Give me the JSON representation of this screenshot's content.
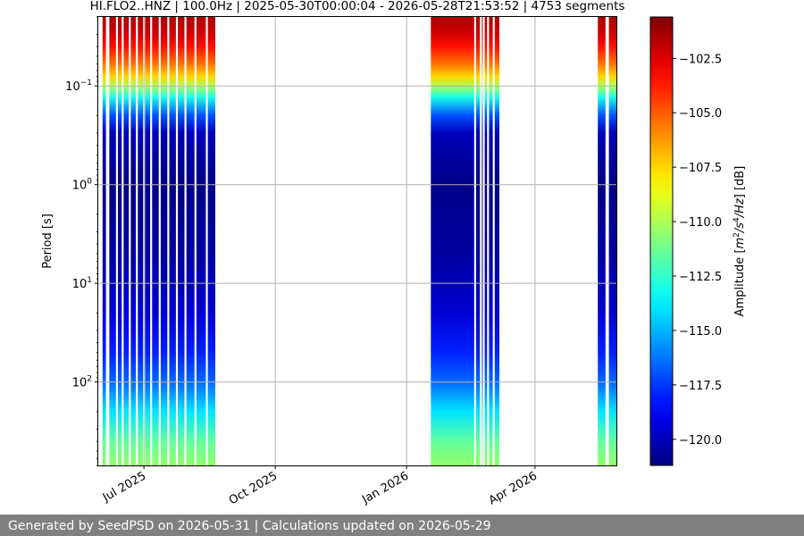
{
  "footer": {
    "text": "Generated by SeedPSD on 2026-05-31 | Calculations updated on 2026-05-29"
  },
  "colors": {
    "grid": "#b0b0b0",
    "footer_bg": "#808080"
  },
  "chart_data": {
    "type": "heatmap",
    "title": "HI.FLO2..HNZ | 100.0Hz | 2025-05-30T00:00:04 - 2026-05-28T21:53:52 | 4753 segments",
    "xlabel": "",
    "ylabel": "Period [s]",
    "colorbar_label": "Amplitude [m²/s⁴/Hz] [dB]",
    "colorbar_label_parts": {
      "prefix": "Amplitude [",
      "unit": "m",
      "e1": "2",
      "mid": "/s",
      "e2": "4",
      "tail": "/Hz",
      "suffix": "] [dB]"
    },
    "xlim": [
      "2025-05-30",
      "2026-05-28"
    ],
    "ylim_period_s": [
      0.02,
      700
    ],
    "y_scale": "log",
    "y_inverted": true,
    "colormap": "jet",
    "clim_db": [
      -121.2,
      -100.6
    ],
    "grid": true,
    "x_ticks": [
      {
        "date": "2025-07-01",
        "label": "Jul 2025"
      },
      {
        "date": "2025-10-01",
        "label": "Oct 2025"
      },
      {
        "date": "2026-01-01",
        "label": "Jan 2026"
      },
      {
        "date": "2026-04-01",
        "label": "Apr 2026"
      }
    ],
    "y_ticks": [
      {
        "value": 0.1,
        "base": "10",
        "exp": "−1"
      },
      {
        "value": 1,
        "base": "10",
        "exp": "0"
      },
      {
        "value": 10,
        "base": "10",
        "exp": "1"
      },
      {
        "value": 100,
        "base": "10",
        "exp": "2"
      }
    ],
    "colorbar_ticks": [
      "−102.5",
      "−105.0",
      "−107.5",
      "−110.0",
      "−112.5",
      "−115.0",
      "−117.5",
      "−120.0"
    ],
    "colorbar_tick_values": [
      -102.5,
      -105.0,
      -107.5,
      -110.0,
      -112.5,
      -115.0,
      -117.5,
      -120.0
    ],
    "data_intervals": [
      {
        "start": "2025-06-02",
        "end": "2025-08-20"
      },
      {
        "start": "2026-01-18",
        "end": "2026-03-07"
      },
      {
        "start": "2026-05-15",
        "end": "2026-05-28"
      }
    ],
    "gaps": [
      "2025-06-05",
      "2025-06-06",
      "2025-06-12",
      "2025-06-16",
      "2025-06-21",
      "2025-06-26",
      "2025-07-01",
      "2025-07-06",
      "2025-07-12",
      "2025-07-18",
      "2025-07-24",
      "2025-07-30",
      "2025-08-06",
      "2025-08-14",
      "2026-02-18",
      "2026-02-22",
      "2026-02-24",
      "2026-02-27",
      "2026-03-03",
      "2026-05-21",
      "2026-05-22"
    ],
    "psd_profile": {
      "period_s": [
        0.02,
        0.03,
        0.04,
        0.06,
        0.08,
        0.1,
        0.13,
        0.2,
        0.3,
        0.5,
        1,
        5,
        20,
        50,
        100,
        200,
        400,
        700
      ],
      "amplitude_db": [
        -101.5,
        -102.3,
        -103.5,
        -105.5,
        -107.5,
        -110,
        -113,
        -117,
        -120,
        -120.5,
        -121,
        -120.5,
        -119.5,
        -118,
        -116.5,
        -114,
        -111.5,
        -110.5
      ]
    }
  }
}
